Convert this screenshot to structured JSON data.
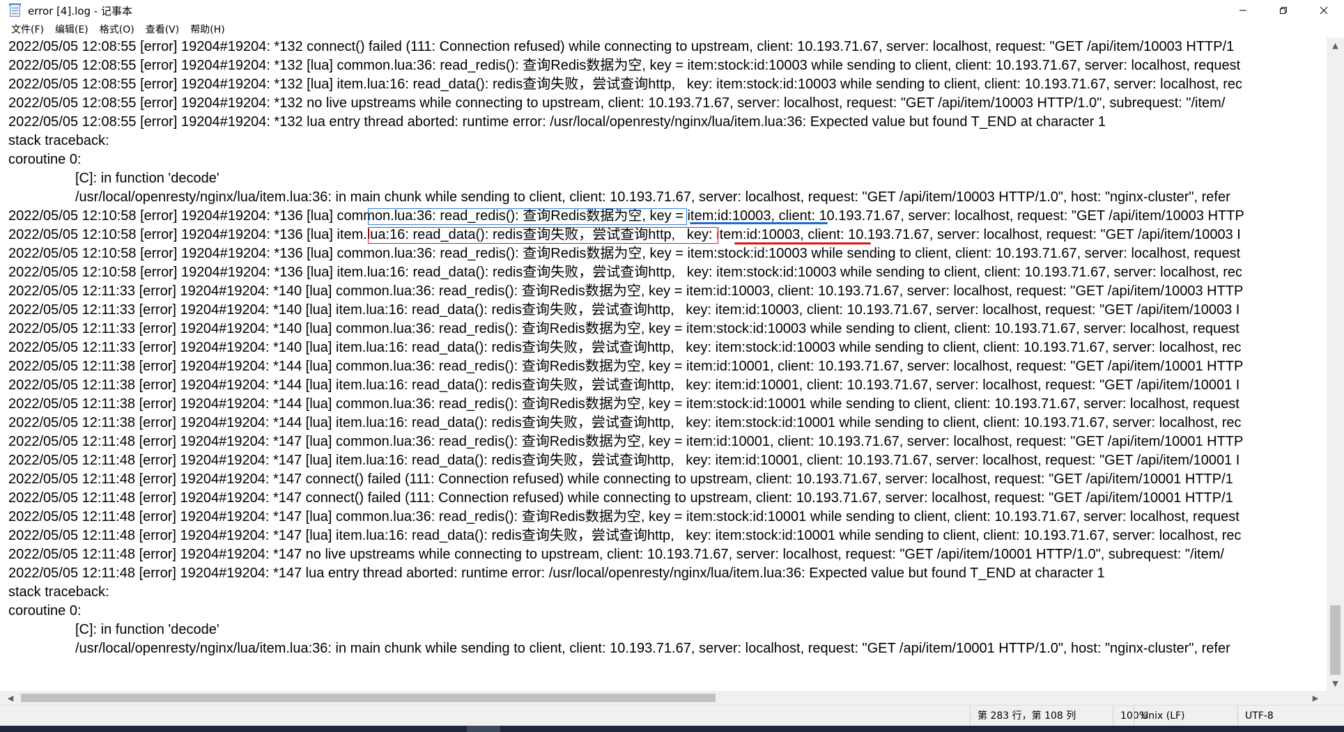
{
  "window": {
    "title": "error [4].log - 记事本",
    "minimize_glyph": "—",
    "maximize_glyph": "❐",
    "close_glyph": "✕"
  },
  "menu": [
    {
      "label": "文件(F)"
    },
    {
      "label": "编辑(E)"
    },
    {
      "label": "格式(O)"
    },
    {
      "label": "查看(V)"
    },
    {
      "label": "帮助(H)"
    }
  ],
  "lines": [
    {
      "text": "2022/05/05 12:08:55 [error] 19204#19204: *132 connect() failed (111: Connection refused) while connecting to upstream, client: 10.193.71.67, server: localhost, request: \"GET /api/item/10003 HTTP/1"
    },
    {
      "text": "2022/05/05 12:08:55 [error] 19204#19204: *132 [lua] common.lua:36: read_redis(): 查询Redis数据为空, key = item:stock:id:10003 while sending to client, client: 10.193.71.67, server: localhost, request"
    },
    {
      "text": "2022/05/05 12:08:55 [error] 19204#19204: *132 [lua] item.lua:16: read_data(): redis查询失败，尝试查询http,   key: item:stock:id:10003 while sending to client, client: 10.193.71.67, server: localhost, rec"
    },
    {
      "text": "2022/05/05 12:08:55 [error] 19204#19204: *132 no live upstreams while connecting to upstream, client: 10.193.71.67, server: localhost, request: \"GET /api/item/10003 HTTP/1.0\", subrequest: \"/item/"
    },
    {
      "text": "2022/05/05 12:08:55 [error] 19204#19204: *132 lua entry thread aborted: runtime error: /usr/local/openresty/nginx/lua/item.lua:36: Expected value but found T_END at character 1"
    },
    {
      "text": "stack traceback:"
    },
    {
      "text": "coroutine 0:"
    },
    {
      "text": "[C]: in function 'decode'",
      "indent": true
    },
    {
      "text": "/usr/local/openresty/nginx/lua/item.lua:36: in main chunk while sending to client, client: 10.193.71.67, server: localhost, request: \"GET /api/item/10003 HTTP/1.0\", host: \"nginx-cluster\", refer",
      "indent": true
    },
    {
      "text": "2022/05/05 12:10:58 [error] 19204#19204: *136 [lua] common.lua:36: read_redis(): 查询Redis数据为空, key = item:id:10003, client: 10.193.71.67, server: localhost, request: \"GET /api/item/10003 HTTP"
    },
    {
      "text": "2022/05/05 12:10:58 [error] 19204#19204: *136 [lua] item.lua:16: read_data(): redis查询失败，尝试查询http,   key: item:id:10003, client: 10.193.71.67, server: localhost, request: \"GET /api/item/10003 I"
    },
    {
      "text": "2022/05/05 12:10:58 [error] 19204#19204: *136 [lua] common.lua:36: read_redis(): 查询Redis数据为空, key = item:stock:id:10003 while sending to client, client: 10.193.71.67, server: localhost, request"
    },
    {
      "text": "2022/05/05 12:10:58 [error] 19204#19204: *136 [lua] item.lua:16: read_data(): redis查询失败，尝试查询http,   key: item:stock:id:10003 while sending to client, client: 10.193.71.67, server: localhost, rec"
    },
    {
      "text": "2022/05/05 12:11:33 [error] 19204#19204: *140 [lua] common.lua:36: read_redis(): 查询Redis数据为空, key = item:id:10003, client: 10.193.71.67, server: localhost, request: \"GET /api/item/10003 HTTP"
    },
    {
      "text": "2022/05/05 12:11:33 [error] 19204#19204: *140 [lua] item.lua:16: read_data(): redis查询失败，尝试查询http,   key: item:id:10003, client: 10.193.71.67, server: localhost, request: \"GET /api/item/10003 I"
    },
    {
      "text": "2022/05/05 12:11:33 [error] 19204#19204: *140 [lua] common.lua:36: read_redis(): 查询Redis数据为空, key = item:stock:id:10003 while sending to client, client: 10.193.71.67, server: localhost, request"
    },
    {
      "text": "2022/05/05 12:11:33 [error] 19204#19204: *140 [lua] item.lua:16: read_data(): redis查询失败，尝试查询http,   key: item:stock:id:10003 while sending to client, client: 10.193.71.67, server: localhost, rec"
    },
    {
      "text": "2022/05/05 12:11:38 [error] 19204#19204: *144 [lua] common.lua:36: read_redis(): 查询Redis数据为空, key = item:id:10001, client: 10.193.71.67, server: localhost, request: \"GET /api/item/10001 HTTP"
    },
    {
      "text": "2022/05/05 12:11:38 [error] 19204#19204: *144 [lua] item.lua:16: read_data(): redis查询失败，尝试查询http,   key: item:id:10001, client: 10.193.71.67, server: localhost, request: \"GET /api/item/10001 I"
    },
    {
      "text": "2022/05/05 12:11:38 [error] 19204#19204: *144 [lua] common.lua:36: read_redis(): 查询Redis数据为空, key = item:stock:id:10001 while sending to client, client: 10.193.71.67, server: localhost, request"
    },
    {
      "text": "2022/05/05 12:11:38 [error] 19204#19204: *144 [lua] item.lua:16: read_data(): redis查询失败，尝试查询http,   key: item:stock:id:10001 while sending to client, client: 10.193.71.67, server: localhost, rec"
    },
    {
      "text": "2022/05/05 12:11:48 [error] 19204#19204: *147 [lua] common.lua:36: read_redis(): 查询Redis数据为空, key = item:id:10001, client: 10.193.71.67, server: localhost, request: \"GET /api/item/10001 HTTP"
    },
    {
      "text": "2022/05/05 12:11:48 [error] 19204#19204: *147 [lua] item.lua:16: read_data(): redis查询失败，尝试查询http,   key: item:id:10001, client: 10.193.71.67, server: localhost, request: \"GET /api/item/10001 I"
    },
    {
      "text": "2022/05/05 12:11:48 [error] 19204#19204: *147 connect() failed (111: Connection refused) while connecting to upstream, client: 10.193.71.67, server: localhost, request: \"GET /api/item/10001 HTTP/1"
    },
    {
      "text": "2022/05/05 12:11:48 [error] 19204#19204: *147 connect() failed (111: Connection refused) while connecting to upstream, client: 10.193.71.67, server: localhost, request: \"GET /api/item/10001 HTTP/1"
    },
    {
      "text": "2022/05/05 12:11:48 [error] 19204#19204: *147 [lua] common.lua:36: read_redis(): 查询Redis数据为空, key = item:stock:id:10001 while sending to client, client: 10.193.71.67, server: localhost, request"
    },
    {
      "text": "2022/05/05 12:11:48 [error] 19204#19204: *147 [lua] item.lua:16: read_data(): redis查询失败，尝试查询http,   key: item:stock:id:10001 while sending to client, client: 10.193.71.67, server: localhost, rec"
    },
    {
      "text": "2022/05/05 12:11:48 [error] 19204#19204: *147 no live upstreams while connecting to upstream, client: 10.193.71.67, server: localhost, request: \"GET /api/item/10001 HTTP/1.0\", subrequest: \"/item/"
    },
    {
      "text": "2022/05/05 12:11:48 [error] 19204#19204: *147 lua entry thread aborted: runtime error: /usr/local/openresty/nginx/lua/item.lua:36: Expected value but found T_END at character 1"
    },
    {
      "text": "stack traceback:"
    },
    {
      "text": "coroutine 0:"
    },
    {
      "text": "[C]: in function 'decode'",
      "indent": true
    },
    {
      "text": "/usr/local/openresty/nginx/lua/item.lua:36: in main chunk while sending to client, client: 10.193.71.67, server: localhost, request: \"GET /api/item/10001 HTTP/1.0\", host: \"nginx-cluster\", refer",
      "indent": true
    }
  ],
  "annotations": {
    "blue_color": "#2f7fd8",
    "red_color": "#e02020"
  },
  "scrollbars": {
    "up_glyph": "▲",
    "down_glyph": "▼",
    "left_glyph": "◀",
    "right_glyph": "▶"
  },
  "status": {
    "position": "第 283 行，第 108 列",
    "zoom": "100%",
    "line_ending": "Unix (LF)",
    "encoding": "UTF-8"
  }
}
